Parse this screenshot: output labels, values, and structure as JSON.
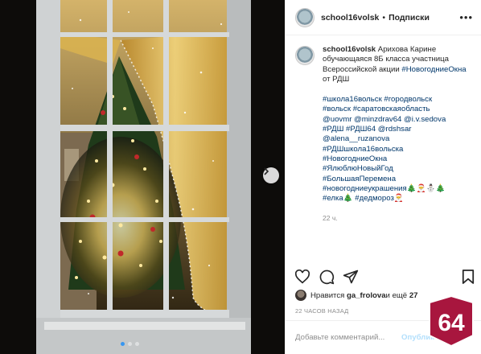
{
  "post": {
    "username": "school16volsk",
    "header_dot": "•",
    "follow_label": "Подписки",
    "more_icon": "more-dots-icon",
    "caption_username": "school16volsk",
    "caption_text": "Арихова Карине обучающаяся 8Б класса участница Всероссийской акции",
    "caption_tag_line": "#НовогодниеОкна",
    "caption_suffix": " от РДШ",
    "hashtags": [
      "#школа16вольск #городвольск",
      "#вольск #саратовскаяобласть",
      "@uovmr @minzdrav64 @i.v.sedova",
      "#РДШ #РДШ64 @rdshsar",
      "@alena__ruzanova",
      "#РДШшкола16вольска",
      "#НовогодниеОкна",
      "#ЯлюблюНовыйГод",
      "#БольшаяПеремена",
      "#новогодниеукрашения🎄🎅⛄🎄",
      "#елка🎄 #дедмороз🎅"
    ],
    "comment_time": "22 ч.",
    "likes_prefix": "Нравится ",
    "likes_user": "ga_frolova",
    "likes_middle": " и ещё ",
    "likes_count": "27",
    "posted_ago": "22 ЧАСОВ НАЗАД",
    "comment_placeholder": "Добавьте комментарий...",
    "publish_label": "Опубликовать"
  },
  "logo": {
    "text": "64",
    "color": "#a8163e"
  },
  "colors": {
    "link": "#00376b",
    "muted": "#8e8e8e",
    "accent": "#3897f0"
  }
}
